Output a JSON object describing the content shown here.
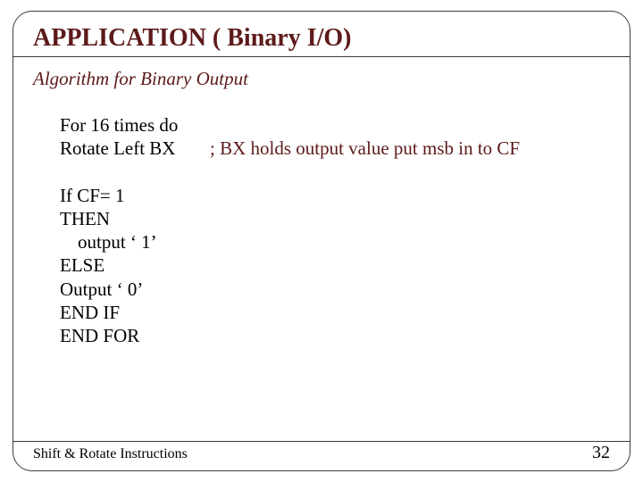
{
  "slide": {
    "title": "APPLICATION ( Binary I/O)",
    "subtitle": "Algorithm for Binary Output",
    "algo": {
      "line1": "For 16 times do",
      "line2_left": "Rotate Left BX",
      "line2_comment": "; BX holds output value put msb in to CF",
      "line3": "If CF= 1",
      "line4": "THEN",
      "line5": "output ‘ 1’",
      "line6": "ELSE",
      "line7": "Output ‘ 0’",
      "line8": "END IF",
      "line9": "END FOR"
    },
    "footer_text": "Shift & Rotate Instructions",
    "page_number": "32"
  }
}
